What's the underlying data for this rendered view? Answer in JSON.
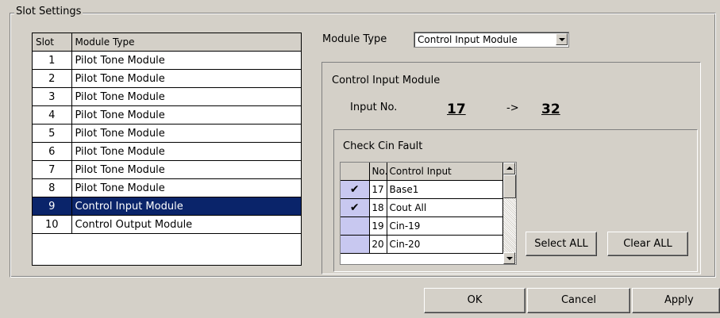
{
  "slot_settings": {
    "title": "Slot Settings",
    "columns": [
      "Slot",
      "Module Type"
    ],
    "rows": [
      {
        "slot": "1",
        "module": "Pilot Tone Module"
      },
      {
        "slot": "2",
        "module": "Pilot Tone Module"
      },
      {
        "slot": "3",
        "module": "Pilot Tone Module"
      },
      {
        "slot": "4",
        "module": "Pilot Tone Module"
      },
      {
        "slot": "5",
        "module": "Pilot Tone Module"
      },
      {
        "slot": "6",
        "module": "Pilot Tone Module"
      },
      {
        "slot": "7",
        "module": "Pilot Tone Module"
      },
      {
        "slot": "8",
        "module": "Pilot Tone Module"
      },
      {
        "slot": "9",
        "module": "Control Input Module"
      },
      {
        "slot": "10",
        "module": "Control Output Module"
      }
    ],
    "selected_row": "9"
  },
  "module_type": {
    "label": "Module Type",
    "selected": "Control Input Module"
  },
  "control_panel": {
    "title": "Control Input Module",
    "input_no_label": "Input No.",
    "input_from": "17",
    "arrow": "->",
    "input_to": "32"
  },
  "cin_fault": {
    "title": "Check Cin Fault",
    "columns": [
      "",
      "No.",
      "Control Input"
    ],
    "rows": [
      {
        "checked": true,
        "check_glyph": "✔",
        "no": "17",
        "name": "Base1"
      },
      {
        "checked": true,
        "check_glyph": "✔",
        "no": "18",
        "name": "Cout All"
      },
      {
        "checked": false,
        "check_glyph": "",
        "no": "19",
        "name": "Cin-19"
      },
      {
        "checked": false,
        "check_glyph": "",
        "no": "20",
        "name": "Cin-20"
      }
    ],
    "select_all_label": "Select ALL",
    "clear_all_label": "Clear ALL"
  },
  "footer": {
    "ok_label": "OK",
    "cancel_label": "Cancel",
    "apply_label": "Apply"
  },
  "colors": {
    "dialog_bg": "#d4d0c8",
    "selection_bg": "#0a246a",
    "check_cell_bg": "#c8c8f0"
  }
}
